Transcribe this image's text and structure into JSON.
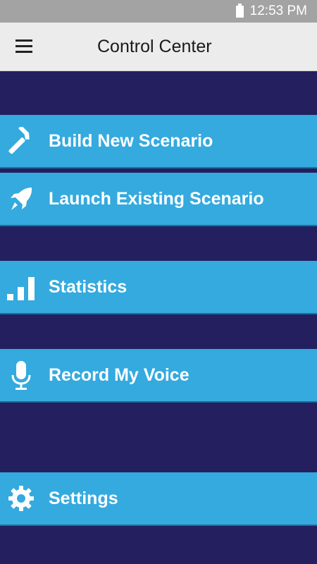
{
  "status_bar": {
    "time": "12:53 PM"
  },
  "header": {
    "title": "Control Center",
    "menu_icon": "hamburger-icon"
  },
  "menu": {
    "items": [
      {
        "label": "Build New Scenario",
        "icon": "hammer-icon"
      },
      {
        "label": "Launch Existing Scenario",
        "icon": "rocket-icon"
      },
      {
        "label": "Statistics",
        "icon": "signal-bars-icon"
      },
      {
        "label": "Record My Voice",
        "icon": "microphone-icon"
      },
      {
        "label": "Settings",
        "icon": "gear-icon"
      }
    ]
  },
  "colors": {
    "background": "#241f5f",
    "item": "#34aadf",
    "header": "#ececec",
    "status_bar": "#a3a3a3"
  }
}
